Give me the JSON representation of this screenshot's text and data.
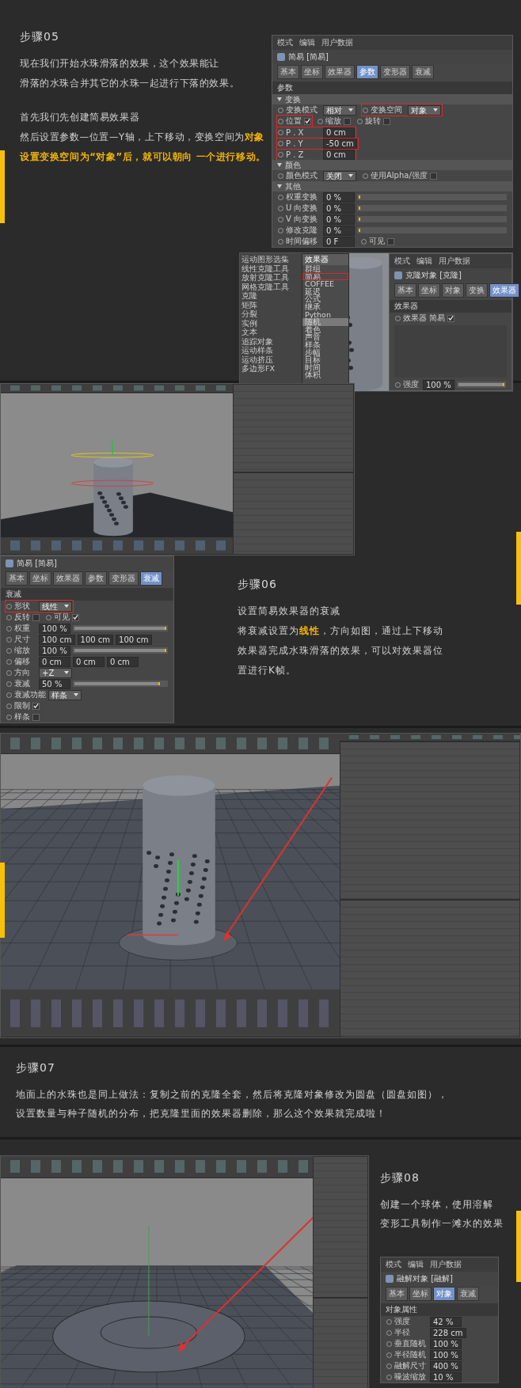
{
  "step05": {
    "title": "步骤05",
    "paragraphs": [
      [
        [
          {
            "text": "现在我们开始水珠滑落的效果，这个效果能让",
            "emphasis": false
          }
        ],
        [
          {
            "text": "滑落的水珠合并其它的水珠一起进行下落的效果。",
            "emphasis": false
          }
        ]
      ],
      [
        [
          {
            "text": "首先我们先创建简易效果器",
            "emphasis": false
          }
        ],
        [
          {
            "text": "然后设置参数—位置—Y轴，上下移动，变换空间为",
            "emphasis": false
          },
          {
            "text": "对象",
            "emphasis": true
          }
        ],
        [
          {
            "text": "设置变换空间为“对象”后，就可以朝向 一个进行移动。",
            "emphasis": true
          }
        ]
      ]
    ],
    "params_panel": {
      "menu": [
        "模式",
        "编辑",
        "用户数据"
      ],
      "title": "简易 [简易]",
      "tabs": [
        {
          "label": "基本",
          "selected": false
        },
        {
          "label": "坐标",
          "selected": false
        },
        {
          "label": "效果器",
          "selected": false
        },
        {
          "label": "参数",
          "selected": true
        },
        {
          "label": "变形器",
          "selected": false
        },
        {
          "label": "衰减",
          "selected": false
        }
      ],
      "rows": [
        {
          "kind": "section",
          "label": "参数"
        },
        {
          "kind": "group",
          "label": "变换"
        },
        {
          "kind": "row",
          "items": [
            {
              "kind": "dropdown",
              "label": "变换模式",
              "value": "相对",
              "highlighted": false
            },
            {
              "kind": "dropdown",
              "label": "变换空间",
              "value": "对象",
              "highlighted": true
            }
          ]
        },
        {
          "kind": "row",
          "items": [
            {
              "kind": "check",
              "label": "位置",
              "checked": true,
              "highlighted": true
            },
            {
              "kind": "check",
              "label": "缩放",
              "checked": false,
              "highlighted": false
            },
            {
              "kind": "check",
              "label": "旋转",
              "checked": false,
              "highlighted": false
            }
          ]
        },
        {
          "kind": "row",
          "items": [
            {
              "kind": "field",
              "label": "P . X",
              "values": [
                "0 cm"
              ],
              "highlighted": true
            }
          ]
        },
        {
          "kind": "row",
          "items": [
            {
              "kind": "field",
              "label": "P . Y",
              "values": [
                "-50 cm"
              ],
              "highlighted": true
            }
          ]
        },
        {
          "kind": "row",
          "items": [
            {
              "kind": "field",
              "label": "P . Z",
              "values": [
                "0 cm"
              ],
              "highlighted": true
            }
          ]
        },
        {
          "kind": "group",
          "label": "颜色"
        },
        {
          "kind": "row",
          "items": [
            {
              "kind": "dropdown",
              "label": "颜色模式",
              "value": "关闭",
              "highlighted": false
            },
            {
              "kind": "check",
              "label": "使用Alpha/强度",
              "checked": false,
              "highlighted": false
            }
          ]
        },
        {
          "kind": "group",
          "label": "其他"
        },
        {
          "kind": "row",
          "items": [
            {
              "kind": "slider",
              "label": "权重变换",
              "value": "0 %",
              "level": 0
            }
          ]
        },
        {
          "kind": "row",
          "items": [
            {
              "kind": "slider",
              "label": "U 向变换",
              "value": "0 %",
              "level": 0
            }
          ]
        },
        {
          "kind": "row",
          "items": [
            {
              "kind": "slider",
              "label": "V 向变换",
              "value": "0 %",
              "level": 0
            }
          ]
        },
        {
          "kind": "row",
          "items": [
            {
              "kind": "slider",
              "label": "修改克隆",
              "value": "0 %",
              "level": 0
            }
          ]
        },
        {
          "kind": "row",
          "items": [
            {
              "kind": "field",
              "label": "时间偏移",
              "values": [
                "0 F"
              ],
              "highlighted": false
            },
            {
              "kind": "check",
              "label": "可见",
              "checked": false,
              "highlighted": false
            }
          ]
        }
      ]
    },
    "tools": [
      "运动图形选集",
      "线性克隆工具",
      "放射克隆工具",
      "网格克隆工具",
      "克隆",
      "矩阵",
      "分裂",
      "实例",
      "文本",
      "追踪对象",
      "运动样条",
      "运动挤压",
      "多边形FX"
    ],
    "effector_menu": {
      "title": "效果器",
      "items": [
        {
          "label": "群组",
          "selected": false,
          "highlighted": false
        },
        {
          "label": "简易",
          "selected": false,
          "highlighted": true
        },
        {
          "label": "COFFEE",
          "selected": false,
          "highlighted": false
        },
        {
          "label": "延迟",
          "selected": false,
          "highlighted": false
        },
        {
          "label": "公式",
          "selected": false,
          "highlighted": false
        },
        {
          "label": "继承",
          "selected": false,
          "highlighted": false
        },
        {
          "label": "Python",
          "selected": false,
          "highlighted": false
        },
        {
          "label": "随机",
          "selected": true,
          "highlighted": false
        },
        {
          "label": "着色",
          "selected": false,
          "highlighted": false
        },
        {
          "label": "声音",
          "selected": false,
          "highlighted": false
        },
        {
          "label": "样条",
          "selected": false,
          "highlighted": false
        },
        {
          "label": "步幅",
          "selected": false,
          "highlighted": false
        },
        {
          "label": "目标",
          "selected": false,
          "highlighted": false
        },
        {
          "label": "时间",
          "selected": false,
          "highlighted": false
        },
        {
          "label": "体积",
          "selected": false,
          "highlighted": false
        }
      ]
    },
    "cloner_panel": {
      "menu": [
        "模式",
        "编辑",
        "用户数据"
      ],
      "title": "克隆对象 [克隆]",
      "tabs": [
        {
          "label": "基本",
          "selected": false
        },
        {
          "label": "坐标",
          "selected": false
        },
        {
          "label": "对象",
          "selected": false
        },
        {
          "label": "变换",
          "selected": false
        },
        {
          "label": "效果器",
          "selected": true
        }
      ],
      "rows": [
        {
          "kind": "section",
          "label": "效果器"
        },
        {
          "kind": "row",
          "items": [
            {
              "kind": "check",
              "label": "效果器 简易",
              "checked": true,
              "highlighted": false
            }
          ]
        },
        {
          "kind": "spacer"
        },
        {
          "kind": "row",
          "items": [
            {
              "kind": "slider",
              "label": "强度",
              "value": "100 %",
              "level": 1
            }
          ]
        }
      ]
    }
  },
  "step06": {
    "title": "步骤06",
    "lines": [
      [
        {
          "text": "设置简易效果器的衰减",
          "emphasis": false
        }
      ],
      [
        {
          "text": "将衰减设置为",
          "emphasis": false
        },
        {
          "text": "线性",
          "emphasis": true
        },
        {
          "text": "，方向如图，通过上下移动",
          "emphasis": false
        }
      ],
      [
        {
          "text": "效果器完成水珠滑落的效果，可以对效果器位",
          "emphasis": false
        }
      ],
      [
        {
          "text": "置进行K帧。",
          "emphasis": false
        }
      ]
    ],
    "falloff_panel": {
      "title": "简易 [简易]",
      "tabs": [
        {
          "label": "基本",
          "selected": false
        },
        {
          "label": "坐标",
          "selected": false
        },
        {
          "label": "效果器",
          "selected": false
        },
        {
          "label": "参数",
          "selected": false
        },
        {
          "label": "变形器",
          "selected": false
        },
        {
          "label": "衰减",
          "selected": true
        }
      ],
      "rows": [
        {
          "kind": "section",
          "label": "衰减"
        },
        {
          "kind": "row",
          "items": [
            {
              "kind": "dropdown",
              "label": "形状",
              "value": "线性",
              "highlighted": true
            }
          ]
        },
        {
          "kind": "row",
          "items": [
            {
              "kind": "check",
              "label": "反转",
              "checked": false,
              "highlighted": false
            },
            {
              "kind": "check",
              "label": "可见",
              "checked": true,
              "highlighted": false
            }
          ]
        },
        {
          "kind": "row",
          "items": [
            {
              "kind": "slider",
              "label": "权重",
              "value": "100 %",
              "level": 1
            }
          ]
        },
        {
          "kind": "row",
          "items": [
            {
              "kind": "field",
              "label": "尺寸",
              "values": [
                "100 cm",
                "100 cm",
                "100 cm"
              ],
              "highlighted": false
            }
          ]
        },
        {
          "kind": "row",
          "items": [
            {
              "kind": "slider",
              "label": "缩放",
              "value": "100 %",
              "level": 1
            }
          ]
        },
        {
          "kind": "row",
          "items": [
            {
              "kind": "field",
              "label": "偏移",
              "values": [
                "0 cm",
                "0 cm",
                "0 cm"
              ],
              "highlighted": false
            }
          ]
        },
        {
          "kind": "row",
          "items": [
            {
              "kind": "dropdown",
              "label": "方向",
              "value": "+Z",
              "highlighted": false
            }
          ]
        },
        {
          "kind": "row",
          "items": [
            {
              "kind": "slider",
              "label": "衰减",
              "value": "50 %",
              "level": 0.93
            }
          ]
        },
        {
          "kind": "row",
          "items": [
            {
              "kind": "dropdown",
              "label": "衰减功能",
              "value": "样条",
              "highlighted": false
            }
          ]
        },
        {
          "kind": "row",
          "items": [
            {
              "kind": "check",
              "label": "限制",
              "checked": true,
              "highlighted": false
            }
          ]
        },
        {
          "kind": "row",
          "items": [
            {
              "kind": "check",
              "label": "样条",
              "checked": false,
              "highlighted": false
            }
          ]
        }
      ]
    }
  },
  "step07": {
    "title": "步骤07",
    "lines": [
      "地面上的水珠也是同上做法：复制之前的克隆全套，然后将克隆对象修改为圆盘（圆盘如图），",
      "设置数量与种子随机的分布，把克隆里面的效果器删除，那么这个效果就完成啦！"
    ]
  },
  "step08": {
    "title": "步骤08",
    "lines": [
      "创建一个球体，使用溶解",
      "变形工具制作一滩水的效果"
    ],
    "melt_panel": {
      "menu": [
        "模式",
        "编辑",
        "用户数据"
      ],
      "title": "融解对象 [融解]",
      "tabs": [
        {
          "label": "基本",
          "selected": false
        },
        {
          "label": "坐标",
          "selected": false
        },
        {
          "label": "对象",
          "selected": true
        },
        {
          "label": "衰减",
          "selected": false
        }
      ],
      "rows": [
        {
          "kind": "section",
          "label": "对象属性"
        },
        {
          "kind": "row",
          "items": [
            {
              "kind": "field",
              "label": "强度",
              "values": [
                "42 %"
              ],
              "highlighted": false
            }
          ]
        },
        {
          "kind": "row",
          "items": [
            {
              "kind": "field",
              "label": "半径",
              "values": [
                "228 cm"
              ],
              "highlighted": false
            }
          ]
        },
        {
          "kind": "row",
          "items": [
            {
              "kind": "field",
              "label": "垂直随机",
              "values": [
                "100 %"
              ],
              "highlighted": false
            }
          ]
        },
        {
          "kind": "row",
          "items": [
            {
              "kind": "field",
              "label": "半径随机",
              "values": [
                "100 %"
              ],
              "highlighted": false
            }
          ]
        },
        {
          "kind": "row",
          "items": [
            {
              "kind": "field",
              "label": "融解尺寸",
              "values": [
                "400 %"
              ],
              "highlighted": false
            }
          ]
        },
        {
          "kind": "row",
          "items": [
            {
              "kind": "field",
              "label": "噪波缩放",
              "values": [
                "10 %"
              ],
              "highlighted": false
            }
          ]
        }
      ]
    }
  }
}
